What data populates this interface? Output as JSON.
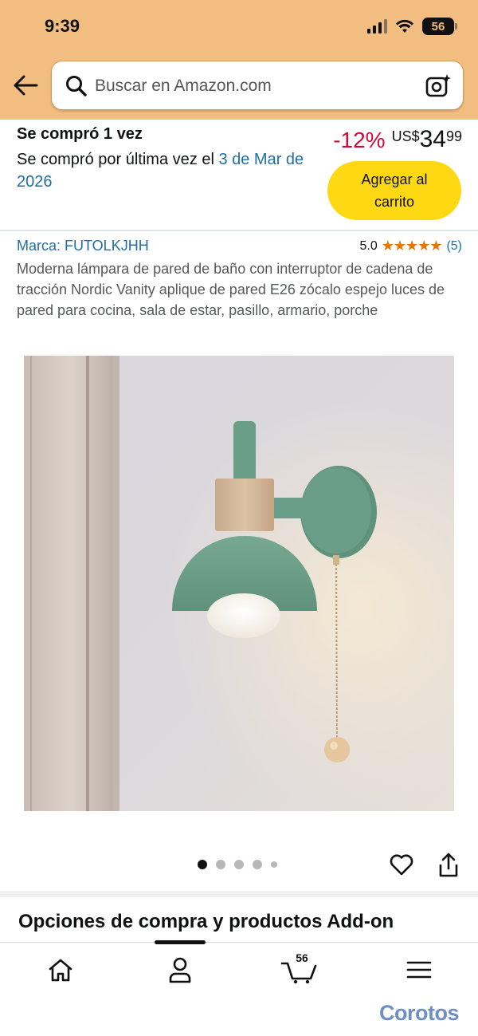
{
  "status_bar": {
    "time": "9:39",
    "battery": "56"
  },
  "search": {
    "placeholder": "Buscar en Amazon.com"
  },
  "purchase_history": {
    "title": "Se compró 1 vez",
    "last_purchase_prefix": "Se compró por última vez el ",
    "last_purchase_date": "3 de Mar de 2026"
  },
  "price": {
    "discount": "-12%",
    "currency": "US$",
    "whole": "34",
    "fraction": "99"
  },
  "add_to_cart": {
    "label": "Agregar al carrito"
  },
  "product": {
    "brand": "Marca: FUTOLKJHH",
    "rating": "5.0",
    "stars": "★★★★★",
    "review_count": "(5)",
    "title": "Moderna lámpara de pared de baño con interruptor de cadena de tracción Nordic Vanity aplique de pared E26 zócalo espejo luces de pared para cocina, sala de estar, pasillo, armario, porche"
  },
  "carousel": {
    "total_images": 5,
    "active_index": 0
  },
  "section": {
    "options_title": "Opciones de compra y productos Add-on"
  },
  "bottom_nav": {
    "items": [
      {
        "name": "home",
        "icon": "home-icon"
      },
      {
        "name": "account",
        "icon": "user-icon"
      },
      {
        "name": "cart",
        "icon": "cart-icon"
      },
      {
        "name": "menu",
        "icon": "menu-icon"
      }
    ],
    "cart_count": "56"
  },
  "watermark": "Corotos",
  "colors": {
    "header_bg": "#f2bd80",
    "add_to_cart": "#ffd814",
    "discount": "#cc0c39",
    "link": "#1f6fa3",
    "star": "#e77600",
    "lamp_green": "#6b9e88"
  }
}
